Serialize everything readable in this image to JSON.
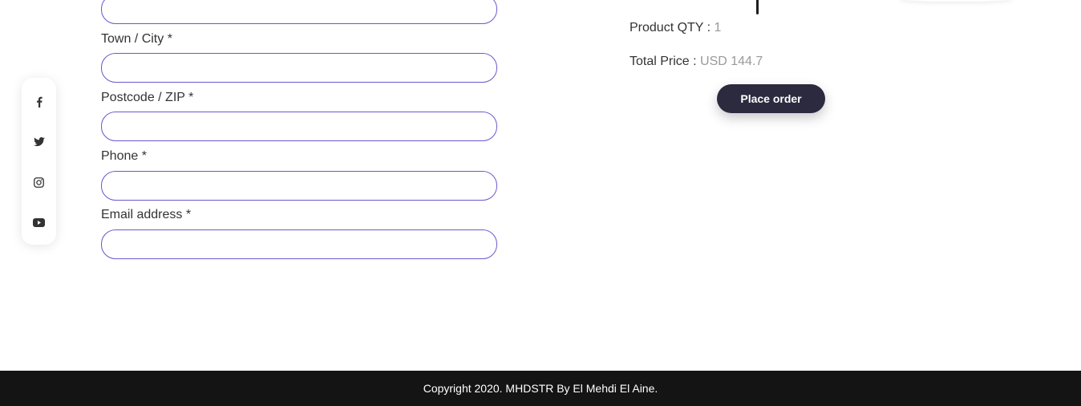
{
  "social": {
    "items": [
      {
        "icon": "facebook-icon"
      },
      {
        "icon": "twitter-icon"
      },
      {
        "icon": "instagram-icon"
      },
      {
        "icon": "youtube-icon"
      }
    ]
  },
  "form": {
    "fields": [
      {
        "label": "",
        "value": ""
      },
      {
        "label": "Town / City *",
        "value": ""
      },
      {
        "label": "Postcode / ZIP *",
        "value": ""
      },
      {
        "label": "Phone *",
        "value": ""
      },
      {
        "label": "Email address *",
        "value": ""
      }
    ]
  },
  "summary": {
    "qty_label": "Product QTY : ",
    "qty_value": "1",
    "total_label": "Total Price : ",
    "total_value": "USD 144.7",
    "place_order_label": "Place order"
  },
  "footer": {
    "copyright": "Copyright 2020. MHDSTR By El Mehdi El Aine."
  },
  "colors": {
    "input_border": "#6a5acd",
    "button_bg": "#2b2a3f",
    "footer_bg": "#141414",
    "muted_value": "#9a9a9a"
  }
}
